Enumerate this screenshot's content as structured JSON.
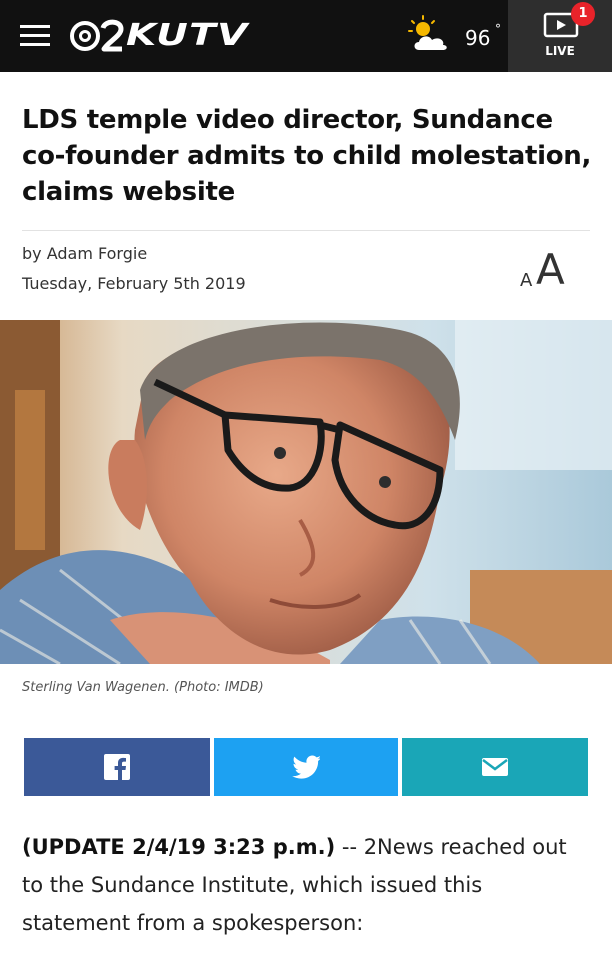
{
  "header": {
    "logo_text": "KUTV",
    "weather_temp": "96",
    "weather_deg": "°",
    "weather_icon": "partly-sunny-icon",
    "live_label": "LIVE",
    "live_badge_count": "1"
  },
  "article": {
    "headline": "LDS temple video director, Sundance co-founder admits to child molestation, claims website",
    "byline": "by Adam Forgie",
    "date": "Tuesday, February 5th 2019",
    "font_size_small": "A",
    "font_size_large": "A",
    "photo_caption": "Sterling Van Wagenen. (Photo: IMDB)",
    "body_update": "(UPDATE 2/4/19 3:23 p.m.)",
    "body_text": " -- 2News reached out to the Sundance Institute, which issued this statement from a spokesperson:"
  },
  "share": {
    "facebook_icon": "facebook-icon",
    "twitter_icon": "twitter-icon",
    "email_icon": "email-icon"
  },
  "colors": {
    "header_bg": "#111111",
    "live_bg": "#2e2e2e",
    "badge": "#e8232a",
    "facebook": "#3b5998",
    "twitter": "#1da1f2",
    "email": "#1aa6b7"
  }
}
